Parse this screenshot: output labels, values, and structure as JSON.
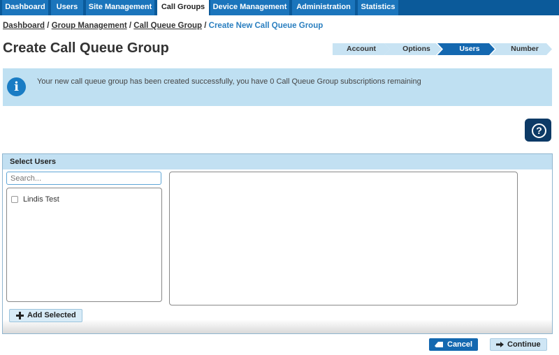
{
  "nav": {
    "tabs": [
      {
        "label": "Dashboard"
      },
      {
        "label": "Users"
      },
      {
        "label": "Site Management"
      },
      {
        "label": "Call Groups"
      },
      {
        "label": "Device Management"
      },
      {
        "label": "Administration"
      },
      {
        "label": "Statistics"
      }
    ],
    "active_tab": "Call Groups"
  },
  "breadcrumb": {
    "items": [
      "Dashboard",
      "Group Management",
      "Call Queue Group"
    ],
    "current": "Create New Call Queue Group",
    "separator": "/"
  },
  "page_title": "Create Call Queue Group",
  "steps": {
    "items": [
      "Account",
      "Options",
      "Users",
      "Number"
    ],
    "current": "Users"
  },
  "info": {
    "icon": "info-icon",
    "icon_glyph": "i",
    "message": "Your new call queue group has been created successfully, you have 0 Call Queue Group subscriptions remaining"
  },
  "help": {
    "icon": "help-icon",
    "glyph": "?"
  },
  "panel": {
    "title": "Select Users",
    "search": {
      "placeholder": "Search...",
      "value": ""
    },
    "available_users": [
      {
        "name": "Lindis Test",
        "checked": false
      }
    ],
    "add_button_label": "Add Selected"
  },
  "actions": {
    "cancel_label": "Cancel",
    "continue_label": "Continue"
  },
  "colors": {
    "nav_bg": "#0b5a9a",
    "tab_bg": "#1b75bc",
    "step_active": "#1468b0",
    "step_inactive": "#c8e3f3",
    "info_bg": "#bfe0f2",
    "primary_button": "#1468b0"
  }
}
